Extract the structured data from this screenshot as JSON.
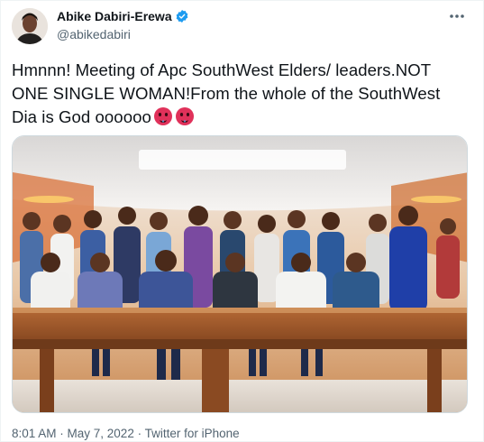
{
  "author": {
    "name": "Abike Dabiri-Erewa",
    "handle": "@abikedabiri",
    "verified": true
  },
  "tweet": {
    "text": "Hmnnn! Meeting of Apc SouthWest Elders/ leaders.NOT ONE SINGLE WOMAN!From the whole of the SouthWest Dia is God oooooo",
    "emojis": [
      "hot-face-emoji",
      "hot-face-emoji"
    ],
    "timestamp": "8:01 AM · May 7, 2022 · Twitter for iPhone"
  },
  "media": {
    "type": "photo",
    "subject": "group of men seated and standing around a conference table"
  },
  "colors": {
    "verified_blue": "#1d9bf0",
    "secondary_text": "#536471",
    "emoji_red": "#e0315a"
  },
  "icons": {
    "more": "more-horizontal-icon",
    "verified": "verified-badge-icon"
  }
}
